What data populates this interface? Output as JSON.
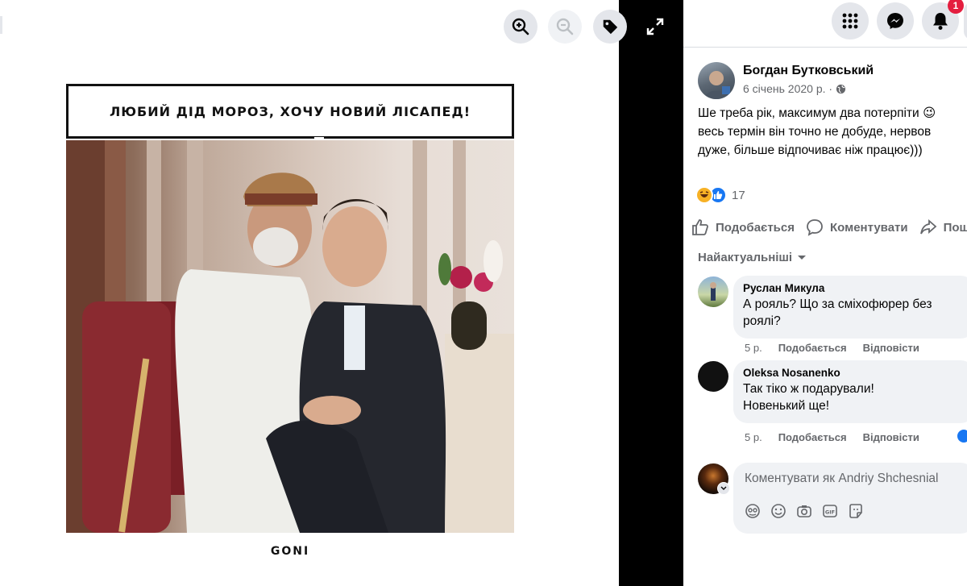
{
  "viewer": {
    "zoom_in_icon": "zoom-in-icon",
    "zoom_out_icon": "zoom-out-icon",
    "tag_icon": "tag-icon",
    "fullscreen_icon": "expand-icon"
  },
  "meme": {
    "caption": "ЛЮБИЙ ДІД МОРОЗ, ХОЧУ НОВИЙ ЛІСАПЕД!",
    "logo": "GONI"
  },
  "topbar": {
    "menu_icon": "grid-menu-icon",
    "messenger_icon": "messenger-icon",
    "notifications_icon": "bell-icon",
    "notification_count": "1"
  },
  "post": {
    "author": "Богдан Бутковський",
    "date": "6 січень 2020 р. ·",
    "privacy_icon": "globe-icon",
    "text_lines": [
      "Ше треба рік, максимум два потерпіти 😉",
      "весь термін він точно не добуде, нервов",
      "дуже, більше відпочиває ніж працює)))"
    ],
    "reaction_count": "17",
    "reaction_icons": [
      "haha-reaction-icon",
      "like-reaction-icon"
    ],
    "actions": [
      {
        "label": "Подобається",
        "icon": "thumbs-up-icon"
      },
      {
        "label": "Коментувати",
        "icon": "comment-icon"
      },
      {
        "label": "Поши",
        "icon": "share-icon"
      }
    ]
  },
  "comments": {
    "sort_label": "Найактуальніші",
    "items": [
      {
        "author": "Руслан Микула",
        "lines": [
          "А рояль? Що за сміхофюрер без",
          "роялі?"
        ],
        "age": "5 р.",
        "like": "Подобається",
        "reply": "Відповісти"
      },
      {
        "author": "Oleksa Nosanenko",
        "lines": [
          "Так тіко ж подарували!",
          "Новенький ще!"
        ],
        "age": "5 р.",
        "like": "Подобається",
        "reply": "Відповісти"
      }
    ],
    "compose_placeholder": "Коментувати як Andriy Shchesnial",
    "compose_tools": [
      "sticker-icon",
      "emoji-icon",
      "camera-icon",
      "gif-icon",
      "sticker-sheet-icon"
    ]
  },
  "colors": {
    "accent": "#1877f2",
    "badge": "#e41e3f",
    "muted_text": "#65676b",
    "bubble_bg": "#f0f2f5"
  }
}
